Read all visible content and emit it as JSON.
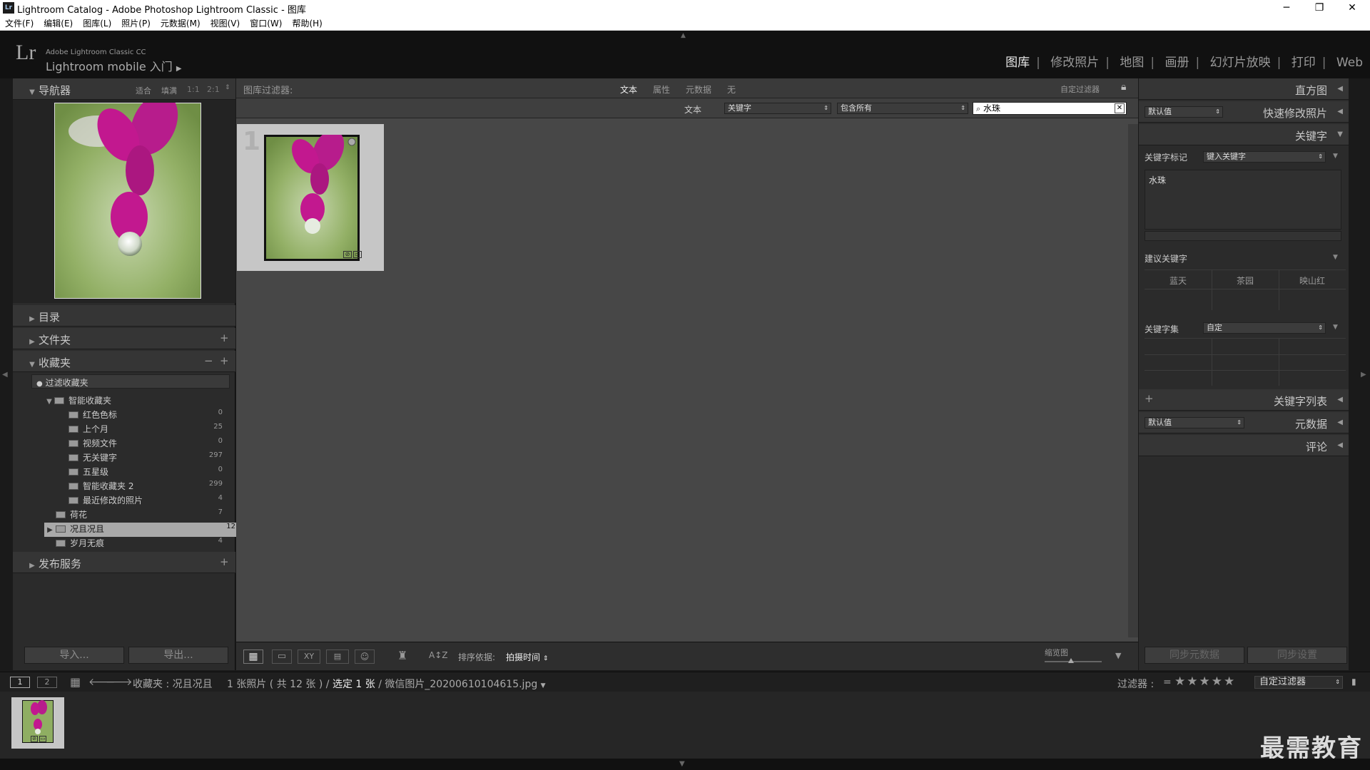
{
  "window": {
    "title": "Lightroom Catalog - Adobe Photoshop Lightroom Classic - 图库",
    "app_icon": "Lr"
  },
  "menu": [
    "文件(F)",
    "编辑(E)",
    "图库(L)",
    "照片(P)",
    "元数据(M)",
    "视图(V)",
    "窗口(W)",
    "帮助(H)"
  ],
  "identity": {
    "logo": "Lr",
    "product": "Adobe Lightroom Classic CC",
    "mobile": "Lightroom mobile 入门"
  },
  "modules": [
    "图库",
    "修改照片",
    "地图",
    "画册",
    "幻灯片放映",
    "打印",
    "Web"
  ],
  "navigator": {
    "title": "导航器",
    "zoom": [
      "适合",
      "填满",
      "1:1",
      "2:1"
    ]
  },
  "left": {
    "catalog": "目录",
    "folders": "文件夹",
    "collections": "收藏夹",
    "filter_placeholder": "过滤收藏夹",
    "smart_group": "智能收藏夹",
    "smart_items": [
      {
        "name": "红色色标",
        "count": "0"
      },
      {
        "name": "上个月",
        "count": "25"
      },
      {
        "name": "视频文件",
        "count": "0"
      },
      {
        "name": "无关键字",
        "count": "297"
      },
      {
        "name": "五星级",
        "count": "0"
      },
      {
        "name": "智能收藏夹 2",
        "count": "299"
      },
      {
        "name": "最近修改的照片",
        "count": "4"
      }
    ],
    "coll_items": [
      {
        "name": "荷花",
        "count": "7"
      },
      {
        "name": "况且况且",
        "count": "12"
      },
      {
        "name": "岁月无痕",
        "count": "4"
      }
    ],
    "publish": "发布服务",
    "import": "导入...",
    "export": "导出..."
  },
  "filterbar": {
    "label": "图库过滤器:",
    "tabs": [
      "文本",
      "属性",
      "元数据",
      "无"
    ],
    "custom": "自定过滤器",
    "text_label": "文本",
    "field": "关键字",
    "rule": "包含所有",
    "search": "水珠"
  },
  "grid": {
    "cell_index": "1"
  },
  "toolbar": {
    "sort_label": "排序依据:",
    "sort_value": "拍摄时间",
    "thumb_label": "缩览图"
  },
  "right": {
    "histogram": "直方图",
    "preset": "默认值",
    "quick_develop": "快速修改照片",
    "keywording": "关键字",
    "kw_tags_label": "关键字标记",
    "kw_tags_value": "键入关键字",
    "kw_text": "水珠",
    "suggestions_label": "建议关键字",
    "suggestions": [
      "蓝天",
      "茶园",
      "映山红"
    ],
    "kwset_label": "关键字集",
    "kwset_value": "自定",
    "kw_list": "关键字列表",
    "meta_preset": "默认值",
    "metadata": "元数据",
    "comments": "评论",
    "sync_meta": "同步元数据",
    "sync_settings": "同步设置"
  },
  "filmstrip": {
    "page1": "1",
    "page2": "2",
    "source": "收藏夹 : 况且况且",
    "info": "1 张照片 ( 共 12 张 ) / ",
    "selected": "选定 1 张",
    "file": " / 微信图片_20200610104615.jpg",
    "filter_label": "过滤器 :",
    "filter_eq": "=",
    "custom": "自定过滤器"
  },
  "watermark": "最需教育",
  "colors": {
    "accent_magenta": "#c2188f",
    "panel": "#2b2b2b",
    "center": "#474747"
  }
}
